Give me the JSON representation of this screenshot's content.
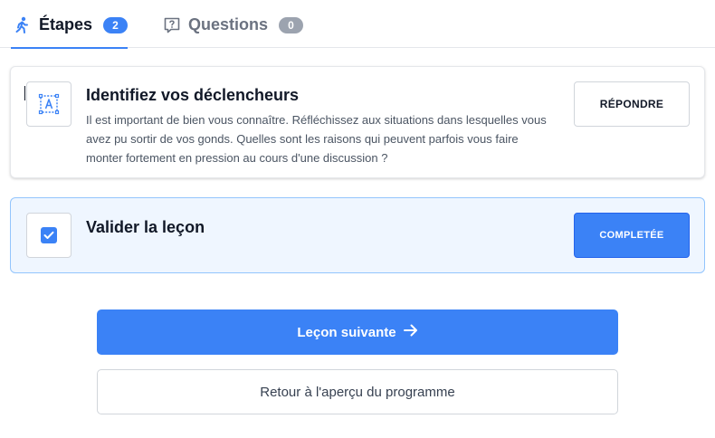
{
  "tabs": [
    {
      "label": "Étapes",
      "count": "2",
      "icon": "runner-icon",
      "active": true
    },
    {
      "label": "Questions",
      "count": "0",
      "icon": "question-square-icon",
      "active": false
    }
  ],
  "steps": [
    {
      "icon": "text-field-icon",
      "title": "Identifiez vos déclencheurs",
      "description": "Il est important de bien vous connaître. Réfléchissez aux situations dans lesquelles vous avez pu sortir de vos gonds. Quelles sont les raisons qui peuvent parfois vous faire monter fortement en pression au cours d'une discussion ?",
      "button_label": "RÉPONDRE"
    },
    {
      "icon": "checkbox-checked-icon",
      "title": "Valider la leçon",
      "button_label": "COMPLETÉE"
    }
  ],
  "actions": {
    "next_label": "Leçon suivante",
    "next_icon": "arrow-right-icon",
    "back_label": "Retour à l'aperçu du programme"
  },
  "colors": {
    "accent": "#3b82f6",
    "badge_inactive": "#9ca3af",
    "completed_card_bg": "#eff6ff"
  }
}
